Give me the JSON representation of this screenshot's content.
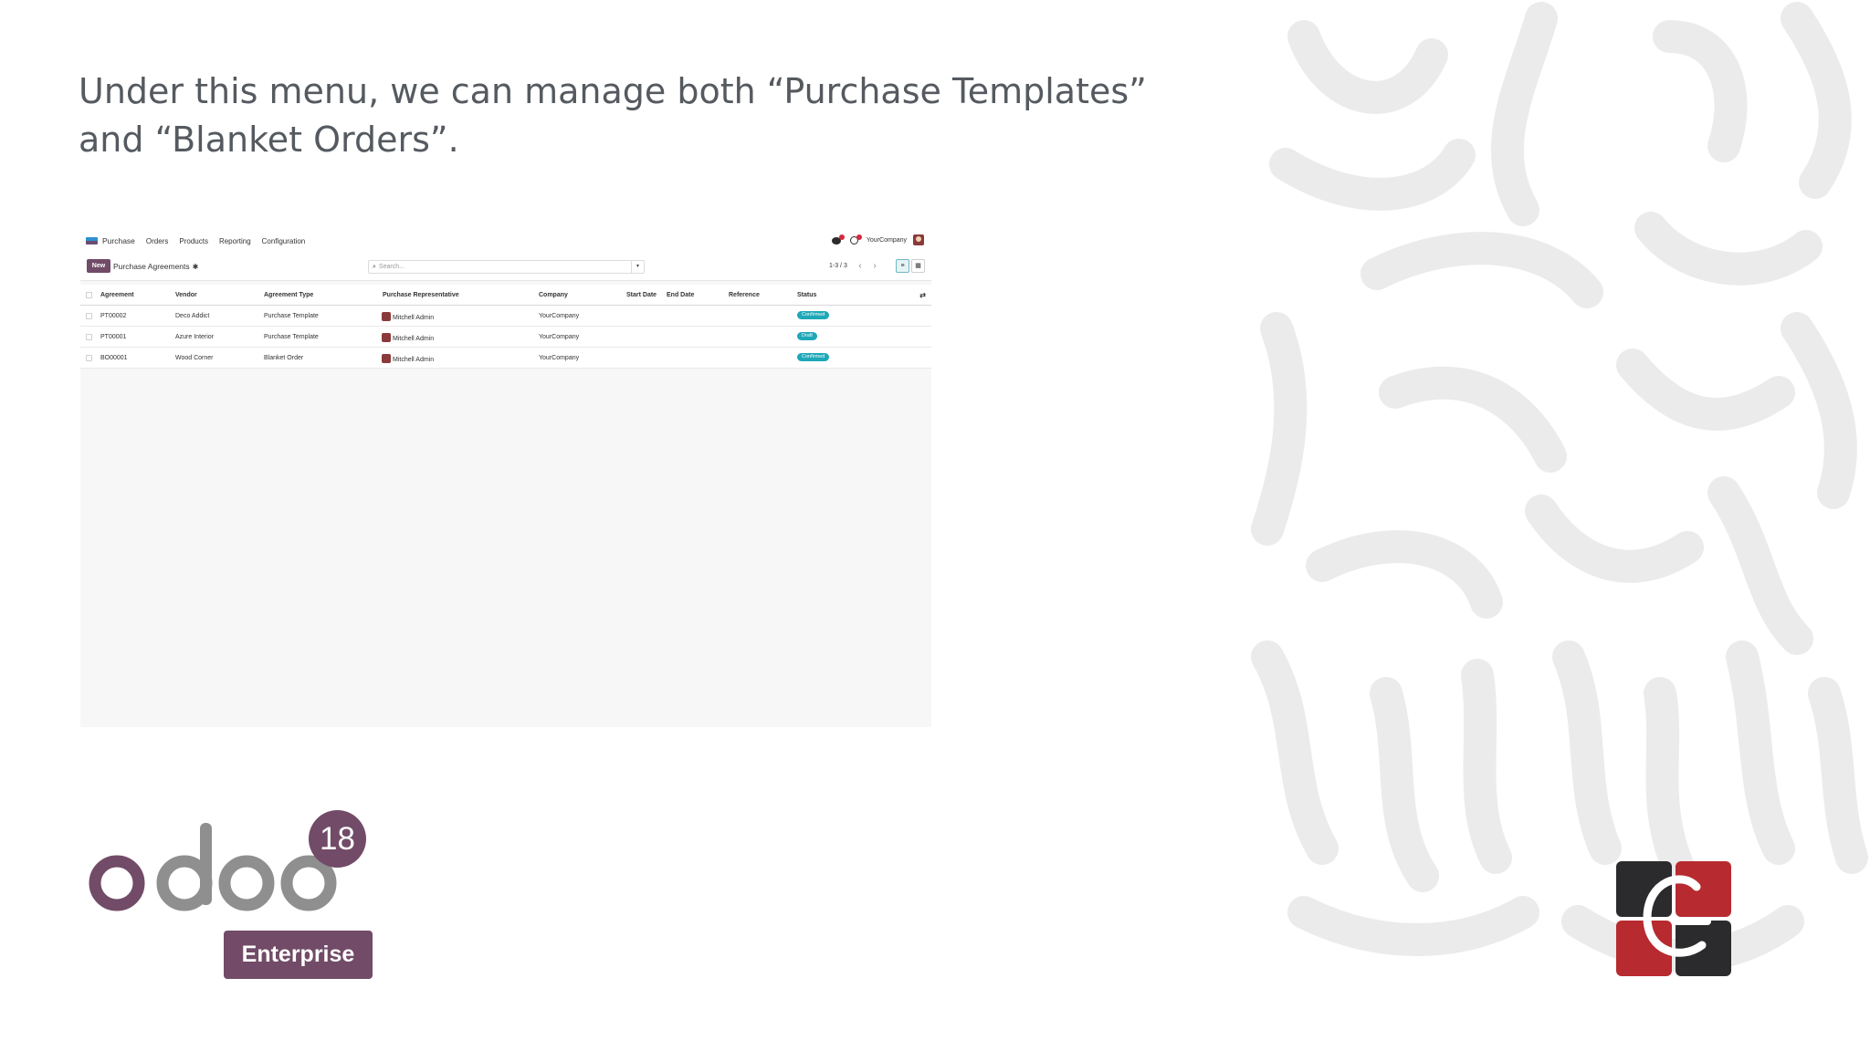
{
  "slide": {
    "heading": "Under this menu, we can manage both “Purchase Templates” and “Blanket Orders”."
  },
  "app": {
    "nav": {
      "app_name": "Purchase",
      "menu": [
        "Orders",
        "Products",
        "Reporting",
        "Configuration"
      ],
      "company": "YourCompany"
    },
    "control": {
      "new_label": "New",
      "view_title": "Purchase Agreements",
      "search_placeholder": "Search...",
      "pager": "1-3 / 3"
    },
    "table": {
      "columns": [
        "Agreement",
        "Vendor",
        "Agreement Type",
        "Purchase Representative",
        "Company",
        "Start Date",
        "End Date",
        "Reference",
        "Status"
      ],
      "rows": [
        {
          "agreement": "PT00002",
          "vendor": "Deco Addict",
          "type": "Purchase Template",
          "rep": "Mitchell Admin",
          "company": "YourCompany",
          "status": "Confirmed"
        },
        {
          "agreement": "PT00001",
          "vendor": "Azure Interior",
          "type": "Purchase Template",
          "rep": "Mitchell Admin",
          "company": "YourCompany",
          "status": "Draft"
        },
        {
          "agreement": "BO00001",
          "vendor": "Wood Corner",
          "type": "Blanket Order",
          "rep": "Mitchell Admin",
          "company": "YourCompany",
          "status": "Confirmed"
        }
      ]
    }
  },
  "branding": {
    "wordmark": "odoo",
    "version": "18",
    "edition": "Enterprise"
  },
  "colors": {
    "odoo_purple": "#714b67",
    "odoo_grey": "#8f8f8f",
    "status_badge": "#1ea8b8",
    "corner_red": "#b72a2f",
    "corner_dark": "#2b2a2c"
  },
  "icons": [
    "messages-icon",
    "activity-clock-icon",
    "user-avatar-icon",
    "search-icon",
    "list-view-icon",
    "kanban-view-icon",
    "optional-columns-icon"
  ]
}
